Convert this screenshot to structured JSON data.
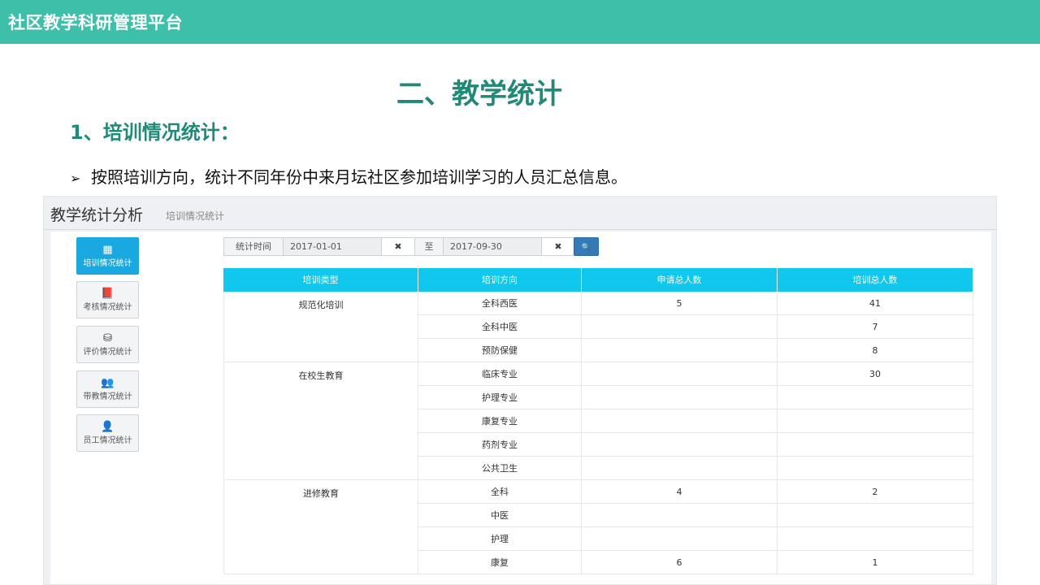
{
  "topbar": {
    "title": "社区教学科研管理平台"
  },
  "slide": {
    "title": "二、教学统计",
    "section": "1、培训情况统计：",
    "bullet_arrow": "➢",
    "bullet_text": "按照培训方向，统计不同年份中来月坛社区参加培训学习的人员汇总信息。"
  },
  "app": {
    "title": "教学统计分析",
    "subtitle": "培训情况统计",
    "sidebar": [
      {
        "label": "培训情况统计",
        "icon": "table-icon",
        "glyph": "▦",
        "active": true
      },
      {
        "label": "考核情况统计",
        "icon": "book-icon",
        "glyph": "📕",
        "active": false
      },
      {
        "label": "评价情况统计",
        "icon": "cubes-icon",
        "glyph": "⛁",
        "active": false
      },
      {
        "label": "带教情况统计",
        "icon": "users-icon",
        "glyph": "👥",
        "active": false
      },
      {
        "label": "员工情况统计",
        "icon": "user-tie-icon",
        "glyph": "👤",
        "active": false
      }
    ],
    "filter": {
      "label": "统计时间",
      "start": "2017-01-01",
      "clear_glyph": "✖",
      "to_label": "至",
      "end": "2017-09-30",
      "search_glyph": "🔍"
    },
    "table": {
      "headers": [
        "培训类型",
        "培训方向",
        "申请总人数",
        "培训总人数"
      ],
      "groups": [
        {
          "type": "规范化培训",
          "rows": [
            {
              "direction": "全科西医",
              "applied": "5",
              "trained": "41"
            },
            {
              "direction": "全科中医",
              "applied": "",
              "trained": "7"
            },
            {
              "direction": "预防保健",
              "applied": "",
              "trained": "8"
            }
          ]
        },
        {
          "type": "在校生教育",
          "rows": [
            {
              "direction": "临床专业",
              "applied": "",
              "trained": "30"
            },
            {
              "direction": "护理专业",
              "applied": "",
              "trained": ""
            },
            {
              "direction": "康复专业",
              "applied": "",
              "trained": ""
            },
            {
              "direction": "药剂专业",
              "applied": "",
              "trained": ""
            },
            {
              "direction": "公共卫生",
              "applied": "",
              "trained": ""
            }
          ]
        },
        {
          "type": "进修教育",
          "rows": [
            {
              "direction": "全科",
              "applied": "4",
              "trained": "2"
            },
            {
              "direction": "中医",
              "applied": "",
              "trained": ""
            },
            {
              "direction": "护理",
              "applied": "",
              "trained": ""
            },
            {
              "direction": "康复",
              "applied": "6",
              "trained": "1"
            }
          ]
        }
      ]
    }
  }
}
